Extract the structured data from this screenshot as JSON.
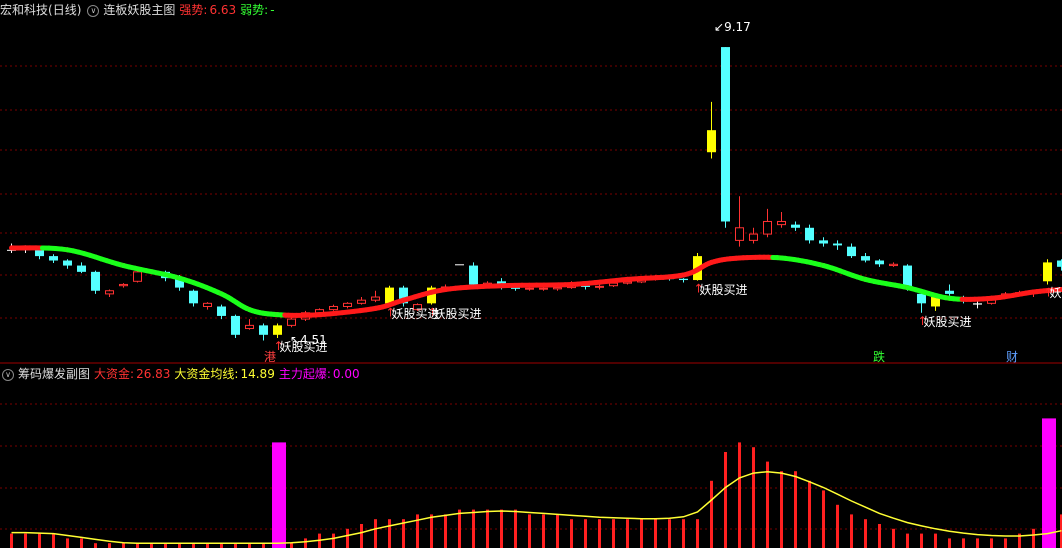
{
  "header_main": {
    "stock": "宏和科技",
    "period": "(日线)",
    "indicator": "连板妖股主图",
    "strong_label": "强势:",
    "strong_value": "6.63",
    "weak_label": "弱势:",
    "weak_value": "-"
  },
  "header_sub": {
    "indicator": "筹码爆发副图",
    "big_money_label": "大资金:",
    "big_money_value": "26.83",
    "avg_label": "大资金均线:",
    "avg_value": "14.89",
    "main_label": "主力起爆:",
    "main_value": "0.00"
  },
  "colors": {
    "up": "#ff3232",
    "down": "#54ffff",
    "signal": "#ffff00",
    "ma_up": "#ff1a1a",
    "ma_down": "#1aff1a",
    "grid": "#7a0000",
    "volume": "#ff2020",
    "volume_avg": "#ffff33",
    "burst": "#ff00ff",
    "strong_label": "#ff3232",
    "weak_label": "#33ff33",
    "main_label": "#ff00ff"
  },
  "annotations": {
    "high_price": "9.17",
    "low_price": "4.51",
    "buy_signal_text": "妖股买进",
    "markers": [
      {
        "text": "港",
        "color": "#ff4040"
      },
      {
        "text": "跌",
        "color": "#33ff33"
      },
      {
        "text": "财",
        "color": "#5f9fff"
      }
    ]
  },
  "chart_data": {
    "type": "candlestick",
    "candles": [
      [
        5.95,
        5.95,
        6.05,
        5.9,
        "n"
      ],
      [
        5.95,
        5.96,
        6.02,
        5.9,
        "n"
      ],
      [
        5.95,
        5.85,
        6.0,
        5.8,
        "d"
      ],
      [
        5.85,
        5.78,
        5.88,
        5.74,
        "d"
      ],
      [
        5.78,
        5.7,
        5.8,
        5.65,
        "d"
      ],
      [
        5.7,
        5.6,
        5.75,
        5.58,
        "d"
      ],
      [
        5.6,
        5.3,
        5.62,
        5.25,
        "d"
      ],
      [
        5.25,
        5.3,
        5.32,
        5.2,
        "u"
      ],
      [
        5.38,
        5.4,
        5.42,
        5.35,
        "u"
      ],
      [
        5.45,
        5.6,
        5.62,
        5.43,
        "u"
      ],
      [
        5.6,
        5.62,
        5.64,
        5.58,
        "u"
      ],
      [
        5.6,
        5.5,
        5.62,
        5.45,
        "d"
      ],
      [
        5.5,
        5.35,
        5.55,
        5.3,
        "d"
      ],
      [
        5.3,
        5.1,
        5.32,
        5.05,
        "d"
      ],
      [
        5.1,
        5.05,
        5.12,
        5.0,
        "u"
      ],
      [
        5.05,
        4.9,
        5.08,
        4.85,
        "d"
      ],
      [
        4.9,
        4.6,
        4.92,
        4.55,
        "d"
      ],
      [
        4.7,
        4.75,
        4.85,
        4.68,
        "u"
      ],
      [
        4.75,
        4.6,
        4.78,
        4.51,
        "d"
      ],
      [
        4.6,
        4.75,
        4.78,
        4.55,
        "s"
      ],
      [
        4.75,
        4.85,
        4.88,
        4.72,
        "u"
      ],
      [
        4.85,
        4.95,
        4.98,
        4.82,
        "u"
      ],
      [
        4.95,
        5.0,
        5.02,
        4.9,
        "u"
      ],
      [
        5.0,
        5.05,
        5.08,
        4.98,
        "u"
      ],
      [
        5.05,
        5.1,
        5.12,
        5.02,
        "u"
      ],
      [
        5.1,
        5.15,
        5.2,
        5.08,
        "u"
      ],
      [
        5.15,
        5.2,
        5.3,
        5.12,
        "u"
      ],
      [
        5.1,
        5.35,
        5.38,
        5.08,
        "s"
      ],
      [
        5.35,
        5.1,
        5.38,
        5.05,
        "d"
      ],
      [
        5.08,
        5.0,
        5.1,
        4.98,
        "u"
      ],
      [
        5.1,
        5.35,
        5.38,
        5.08,
        "s"
      ],
      [
        5.35,
        5.36,
        5.4,
        5.3,
        "u"
      ],
      [
        5.72,
        5.72,
        5.72,
        5.72,
        "n"
      ],
      [
        5.7,
        5.4,
        5.75,
        5.38,
        "d"
      ],
      [
        5.4,
        5.42,
        5.45,
        5.38,
        "u"
      ],
      [
        5.45,
        5.35,
        5.5,
        5.32,
        "d"
      ],
      [
        5.35,
        5.33,
        5.38,
        5.3,
        "d"
      ],
      [
        5.33,
        5.34,
        5.38,
        5.3,
        "u"
      ],
      [
        5.34,
        5.33,
        5.36,
        5.3,
        "u"
      ],
      [
        5.33,
        5.35,
        5.4,
        5.3,
        "u"
      ],
      [
        5.35,
        5.38,
        5.45,
        5.33,
        "u"
      ],
      [
        5.38,
        5.36,
        5.4,
        5.32,
        "d"
      ],
      [
        5.36,
        5.37,
        5.4,
        5.32,
        "u"
      ],
      [
        5.38,
        5.42,
        5.45,
        5.36,
        "u"
      ],
      [
        5.42,
        5.44,
        5.46,
        5.4,
        "u"
      ],
      [
        5.44,
        5.48,
        5.5,
        5.42,
        "u"
      ],
      [
        5.48,
        5.5,
        5.55,
        5.46,
        "u"
      ],
      [
        5.5,
        5.49,
        5.52,
        5.46,
        "d"
      ],
      [
        5.49,
        5.47,
        5.5,
        5.43,
        "d"
      ],
      [
        5.47,
        5.85,
        5.9,
        5.46,
        "s"
      ],
      [
        7.5,
        7.85,
        8.3,
        7.4,
        "s"
      ],
      [
        9.17,
        6.4,
        9.17,
        6.3,
        "d"
      ],
      [
        6.3,
        6.1,
        6.8,
        6.0,
        "u"
      ],
      [
        6.1,
        6.2,
        6.3,
        6.05,
        "u"
      ],
      [
        6.2,
        6.4,
        6.6,
        6.15,
        "u"
      ],
      [
        6.4,
        6.35,
        6.55,
        6.3,
        "u"
      ],
      [
        6.35,
        6.3,
        6.4,
        6.25,
        "d"
      ],
      [
        6.3,
        6.1,
        6.35,
        6.05,
        "d"
      ],
      [
        6.1,
        6.05,
        6.15,
        6.0,
        "d"
      ],
      [
        6.05,
        6.02,
        6.1,
        5.95,
        "d"
      ],
      [
        6.0,
        5.85,
        6.05,
        5.82,
        "d"
      ],
      [
        5.85,
        5.78,
        5.9,
        5.75,
        "d"
      ],
      [
        5.78,
        5.72,
        5.8,
        5.68,
        "d"
      ],
      [
        5.72,
        5.7,
        5.75,
        5.68,
        "u"
      ],
      [
        5.7,
        5.35,
        5.72,
        5.3,
        "d"
      ],
      [
        5.25,
        5.1,
        5.28,
        4.95,
        "d"
      ],
      [
        5.05,
        5.2,
        5.22,
        4.98,
        "s"
      ],
      [
        5.3,
        5.25,
        5.4,
        5.22,
        "d"
      ],
      [
        5.2,
        5.18,
        5.22,
        5.1,
        "d"
      ],
      [
        5.08,
        5.1,
        5.15,
        5.02,
        "n"
      ],
      [
        5.1,
        5.15,
        5.2,
        5.08,
        "u"
      ],
      [
        5.2,
        5.25,
        5.28,
        5.18,
        "u"
      ],
      [
        5.26,
        5.27,
        5.3,
        5.24,
        "u"
      ],
      [
        5.27,
        5.28,
        5.32,
        5.2,
        "u"
      ],
      [
        5.45,
        5.75,
        5.8,
        5.4,
        "s"
      ],
      [
        5.68,
        5.78,
        5.8,
        5.62,
        "d"
      ]
    ],
    "ylim": [
      4.2,
      9.6
    ],
    "high": 9.17,
    "low": 4.51,
    "signal_bars": [
      19,
      27,
      30,
      49,
      65,
      74
    ],
    "ma": [
      [
        0,
        5.98
      ],
      [
        4,
        5.95
      ],
      [
        8,
        5.7
      ],
      [
        12,
        5.5
      ],
      [
        15,
        5.25
      ],
      [
        17,
        5.0
      ],
      [
        19,
        4.92
      ],
      [
        22,
        4.92
      ],
      [
        26,
        5.02
      ],
      [
        28,
        5.15
      ],
      [
        31,
        5.32
      ],
      [
        35,
        5.38
      ],
      [
        40,
        5.4
      ],
      [
        44,
        5.48
      ],
      [
        48,
        5.55
      ],
      [
        50,
        5.75
      ],
      [
        52,
        5.82
      ],
      [
        55,
        5.82
      ],
      [
        58,
        5.7
      ],
      [
        61,
        5.48
      ],
      [
        64,
        5.35
      ],
      [
        67,
        5.18
      ],
      [
        70,
        5.18
      ],
      [
        73,
        5.28
      ],
      [
        75,
        5.32
      ]
    ],
    "volume": [
      3,
      3,
      3,
      3,
      2,
      2,
      1,
      1,
      1,
      1,
      1,
      1,
      1,
      1,
      1,
      1,
      1,
      1,
      1,
      0,
      1,
      2,
      3,
      3,
      4,
      5,
      6,
      6,
      6,
      7,
      7,
      7,
      8,
      8,
      8,
      8,
      8,
      7,
      7,
      7,
      6,
      6,
      6,
      6,
      6,
      6,
      6,
      6,
      6,
      6,
      14,
      20,
      22,
      21,
      18,
      16,
      16,
      14,
      12,
      9,
      7,
      6,
      5,
      4,
      3,
      3,
      3,
      2,
      2,
      2,
      2,
      2,
      3,
      4,
      5,
      7
    ],
    "volume_avg": [
      3.2,
      3.2,
      3.1,
      3.0,
      2.6,
      2.2,
      1.8,
      1.4,
      1.1,
      1.0,
      1.0,
      1.0,
      1.0,
      1.0,
      1.0,
      1.0,
      1.0,
      1.0,
      1.0,
      1.0,
      1.1,
      1.3,
      1.6,
      2.0,
      2.6,
      3.2,
      4.0,
      4.6,
      5.2,
      5.8,
      6.4,
      6.8,
      7.2,
      7.4,
      7.6,
      7.7,
      7.6,
      7.4,
      7.2,
      7.0,
      6.8,
      6.6,
      6.4,
      6.3,
      6.2,
      6.1,
      6.1,
      6.2,
      6.5,
      7.5,
      10.0,
      12.6,
      14.6,
      15.6,
      15.9,
      15.6,
      14.9,
      13.8,
      12.6,
      11.2,
      9.8,
      8.5,
      7.2,
      6.2,
      5.3,
      4.6,
      4.0,
      3.5,
      3.1,
      2.8,
      2.6,
      2.5,
      2.5,
      2.7,
      3.0,
      3.6
    ],
    "burst_bars": [
      {
        "index": 19,
        "value": 22
      },
      {
        "index": 74,
        "value": 27
      }
    ],
    "volume_ylim": [
      0,
      30
    ]
  }
}
